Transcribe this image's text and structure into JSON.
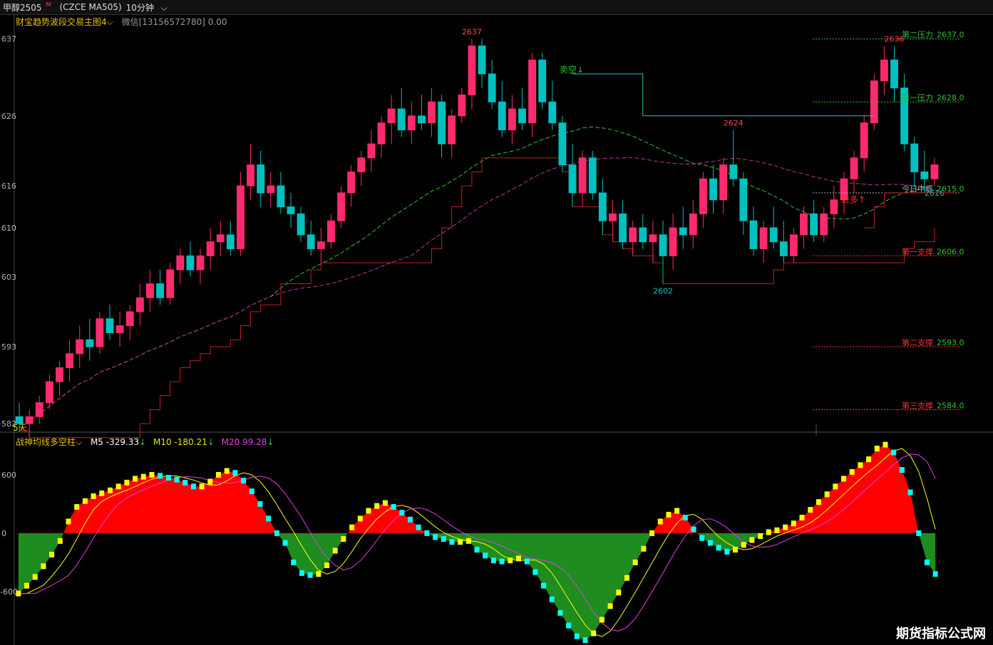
{
  "toolbar": {
    "symbol": "甲醇2505",
    "symbol_badge": "M",
    "code": "(CZCE MA505)",
    "period": "10分钟"
  },
  "main_indicator": {
    "name": "财宝趋势波段交易主图4",
    "wechat": "微信[13156572780] 0.00"
  },
  "sub_indicator": {
    "name": "战神均线多空柱",
    "m5": "M5 -329.33",
    "m10": "M10 -180.21",
    "m20": "M20 99.28",
    "m5_arrow": "↓",
    "m10_arrow": "↓",
    "m20_arrow": "↓"
  },
  "watermark": "期货指标公式网",
  "colors": {
    "up": "#ff2a6d",
    "down": "#00c0c0",
    "red": "#ff0000",
    "green": "#1e8c1e",
    "yellow": "#ffff00",
    "cyan": "#00ffff",
    "magenta": "#e040e0"
  },
  "chart_data": [
    {
      "type": "candlestick",
      "y_axis_ticks": [
        "637",
        "626",
        "616",
        "610",
        "603",
        "593",
        "582"
      ],
      "y_axis_tick_values": [
        2637,
        2626,
        2616,
        2610,
        2603,
        2593,
        2582
      ],
      "ylim": [
        2581.5,
        2638.5
      ],
      "bottom_label": "5天",
      "candles": [
        [
          2583,
          2585,
          2581,
          2582
        ],
        [
          2582,
          2584,
          2580,
          2583
        ],
        [
          2583,
          2586,
          2582,
          2585
        ],
        [
          2585,
          2589,
          2584,
          2588
        ],
        [
          2588,
          2591,
          2586,
          2590
        ],
        [
          2590,
          2594,
          2588,
          2592
        ],
        [
          2592,
          2596,
          2590,
          2594
        ],
        [
          2594,
          2597,
          2591,
          2593
        ],
        [
          2593,
          2598,
          2592,
          2597
        ],
        [
          2597,
          2599,
          2594,
          2595
        ],
        [
          2595,
          2598,
          2593,
          2596
        ],
        [
          2596,
          2599,
          2594,
          2598
        ],
        [
          2598,
          2602,
          2596,
          2600
        ],
        [
          2600,
          2604,
          2598,
          2602
        ],
        [
          2602,
          2604,
          2599,
          2600
        ],
        [
          2600,
          2605,
          2599,
          2604
        ],
        [
          2604,
          2607,
          2602,
          2606
        ],
        [
          2606,
          2608,
          2603,
          2604
        ],
        [
          2604,
          2607,
          2602,
          2606
        ],
        [
          2606,
          2610,
          2604,
          2608
        ],
        [
          2608,
          2611,
          2606,
          2609
        ],
        [
          2609,
          2611,
          2606,
          2607
        ],
        [
          2607,
          2618,
          2606,
          2616
        ],
        [
          2616,
          2622,
          2614,
          2619
        ],
        [
          2619,
          2621,
          2613,
          2615
        ],
        [
          2615,
          2618,
          2613,
          2616
        ],
        [
          2616,
          2618,
          2612,
          2613
        ],
        [
          2613,
          2615,
          2610,
          2612
        ],
        [
          2612,
          2613,
          2608,
          2609
        ],
        [
          2609,
          2611,
          2606,
          2607
        ],
        [
          2607,
          2610,
          2605,
          2608
        ],
        [
          2608,
          2612,
          2607,
          2611
        ],
        [
          2611,
          2616,
          2610,
          2615
        ],
        [
          2615,
          2619,
          2613,
          2618
        ],
        [
          2618,
          2621,
          2616,
          2620
        ],
        [
          2620,
          2624,
          2618,
          2622
        ],
        [
          2622,
          2626,
          2620,
          2625
        ],
        [
          2625,
          2629,
          2622,
          2627
        ],
        [
          2627,
          2630,
          2623,
          2624
        ],
        [
          2624,
          2628,
          2622,
          2626
        ],
        [
          2626,
          2629,
          2624,
          2625
        ],
        [
          2625,
          2630,
          2623,
          2628
        ],
        [
          2628,
          2629,
          2620,
          2622
        ],
        [
          2622,
          2627,
          2620,
          2626
        ],
        [
          2626,
          2630,
          2625,
          2629
        ],
        [
          2629,
          2637,
          2627,
          2636
        ],
        [
          2636,
          2637,
          2630,
          2632
        ],
        [
          2632,
          2634,
          2627,
          2628
        ],
        [
          2628,
          2631,
          2623,
          2624
        ],
        [
          2624,
          2629,
          2622,
          2627
        ],
        [
          2627,
          2630,
          2624,
          2625
        ],
        [
          2625,
          2635,
          2623,
          2634
        ],
        [
          2634,
          2635,
          2627,
          2628
        ],
        [
          2628,
          2631,
          2624,
          2625
        ],
        [
          2625,
          2626,
          2618,
          2619
        ],
        [
          2619,
          2622,
          2613,
          2615
        ],
        [
          2615,
          2621,
          2613,
          2620
        ],
        [
          2620,
          2621,
          2614,
          2615
        ],
        [
          2615,
          2617,
          2609,
          2611
        ],
        [
          2611,
          2614,
          2608,
          2612
        ],
        [
          2612,
          2614,
          2607,
          2608
        ],
        [
          2608,
          2611,
          2606,
          2610
        ],
        [
          2610,
          2612,
          2607,
          2608
        ],
        [
          2608,
          2611,
          2605,
          2609
        ],
        [
          2609,
          2611,
          2602,
          2606
        ],
        [
          2606,
          2612,
          2604,
          2610
        ],
        [
          2610,
          2613,
          2607,
          2609
        ],
        [
          2609,
          2614,
          2607,
          2612
        ],
        [
          2612,
          2618,
          2610,
          2617
        ],
        [
          2617,
          2619,
          2612,
          2614
        ],
        [
          2614,
          2620,
          2612,
          2619
        ],
        [
          2619,
          2624,
          2616,
          2617
        ],
        [
          2617,
          2618,
          2609,
          2611
        ],
        [
          2611,
          2613,
          2606,
          2607
        ],
        [
          2607,
          2611,
          2605,
          2610
        ],
        [
          2610,
          2613,
          2607,
          2608
        ],
        [
          2608,
          2611,
          2605,
          2606
        ],
        [
          2606,
          2610,
          2605,
          2609
        ],
        [
          2609,
          2613,
          2607,
          2612
        ],
        [
          2612,
          2614,
          2608,
          2609
        ],
        [
          2609,
          2613,
          2608,
          2612
        ],
        [
          2612,
          2616,
          2610,
          2614
        ],
        [
          2614,
          2618,
          2612,
          2617
        ],
        [
          2617,
          2621,
          2615,
          2620
        ],
        [
          2620,
          2626,
          2618,
          2625
        ],
        [
          2625,
          2632,
          2624,
          2631
        ],
        [
          2631,
          2636,
          2629,
          2634
        ],
        [
          2634,
          2636,
          2628,
          2630
        ],
        [
          2630,
          2632,
          2621,
          2622
        ],
        [
          2622,
          2623,
          2616,
          2618
        ],
        [
          2618,
          2621,
          2615,
          2617
        ],
        [
          2617,
          2620,
          2616,
          2619
        ]
      ],
      "price_labels": [
        {
          "text": "2637",
          "color": "#ff4444",
          "price": 2637,
          "index": 45
        },
        {
          "text": "2636",
          "color": "#ff4444",
          "price": 2636,
          "index": 87
        },
        {
          "text": "2624",
          "color": "#ff4444",
          "price": 2624,
          "index": 71
        },
        {
          "text": "2602",
          "color": "#00c0c0",
          "price": 2602,
          "index": 64
        },
        {
          "text": "2616",
          "color": "#00c0c0",
          "price": 2616,
          "index": 91
        }
      ],
      "levels": [
        {
          "label": "第二压力",
          "value": "2637.0",
          "price": 2637,
          "color": "#30c030"
        },
        {
          "label": "第一压力",
          "value": "2628.0",
          "price": 2628,
          "color": "#30c030"
        },
        {
          "label": "今日中枢",
          "value": "2615.0",
          "price": 2615,
          "color": "#aaaaaa"
        },
        {
          "label": "第一支撑",
          "value": "2606.0",
          "price": 2606,
          "color": "#ff3030"
        },
        {
          "label": "第二支撑",
          "value": "2593.0",
          "price": 2593,
          "color": "#ff3030"
        },
        {
          "label": "第三支撑",
          "value": "2584.0",
          "price": 2584,
          "color": "#ff3030"
        }
      ],
      "signals": [
        {
          "text": "卖空↓",
          "color": "#30c030"
        },
        {
          "text": "进多↑",
          "color": "#ff3030"
        }
      ]
    },
    {
      "type": "bar",
      "y_axis_ticks": [
        "600",
        "0",
        "-600"
      ],
      "y_axis_tick_values": [
        600,
        0,
        -600
      ],
      "ylim": [
        -1150,
        900
      ],
      "histogram": [
        -620,
        -540,
        -450,
        -340,
        -220,
        -80,
        120,
        270,
        330,
        380,
        410,
        440,
        480,
        520,
        560,
        580,
        600,
        590,
        570,
        550,
        520,
        480,
        480,
        530,
        600,
        640,
        620,
        540,
        430,
        300,
        150,
        0,
        -100,
        -300,
        -410,
        -430,
        -420,
        -330,
        -180,
        -60,
        60,
        150,
        230,
        280,
        310,
        270,
        210,
        140,
        60,
        0,
        -40,
        -60,
        -90,
        -90,
        -80,
        -170,
        -230,
        -280,
        -290,
        -280,
        -260,
        -290,
        -400,
        -540,
        -680,
        -820,
        -950,
        -1060,
        -1100,
        -1030,
        -890,
        -750,
        -610,
        -460,
        -300,
        -160,
        0,
        120,
        190,
        230,
        160,
        40,
        -50,
        -100,
        -150,
        -190,
        -170,
        -120,
        -70,
        -30,
        10,
        30,
        60,
        100,
        160,
        240,
        320,
        400,
        480,
        560,
        630,
        700,
        760,
        870,
        910,
        830,
        650,
        420,
        0,
        -300,
        -420
      ],
      "m5": [
        -620,
        -540,
        -450,
        -340,
        -220,
        -80,
        120,
        270,
        330,
        380,
        410,
        440,
        480,
        520,
        560,
        580,
        600,
        590,
        570,
        550,
        520,
        480,
        480,
        530,
        600,
        640,
        620,
        540,
        430,
        300,
        150,
        0,
        -100,
        -300,
        -410,
        -430,
        -420,
        -330,
        -180,
        -60,
        60,
        150,
        230,
        280,
        310,
        270,
        210,
        140,
        60,
        0,
        -40,
        -60,
        -90,
        -90,
        -80,
        -170,
        -230,
        -280,
        -290,
        -280,
        -260,
        -290,
        -400,
        -540,
        -680,
        -820,
        -950,
        -1060,
        -1100,
        -1030,
        -890,
        -750,
        -610,
        -460,
        -300,
        -160,
        0,
        120,
        190,
        230,
        160,
        40,
        -50,
        -100,
        -150,
        -190,
        -170,
        -120,
        -70,
        -30,
        10,
        30,
        60,
        100,
        160,
        240,
        320,
        400,
        480,
        560,
        630,
        700,
        760,
        870,
        910,
        830,
        650,
        420,
        0,
        -300,
        -420
      ]
    }
  ]
}
